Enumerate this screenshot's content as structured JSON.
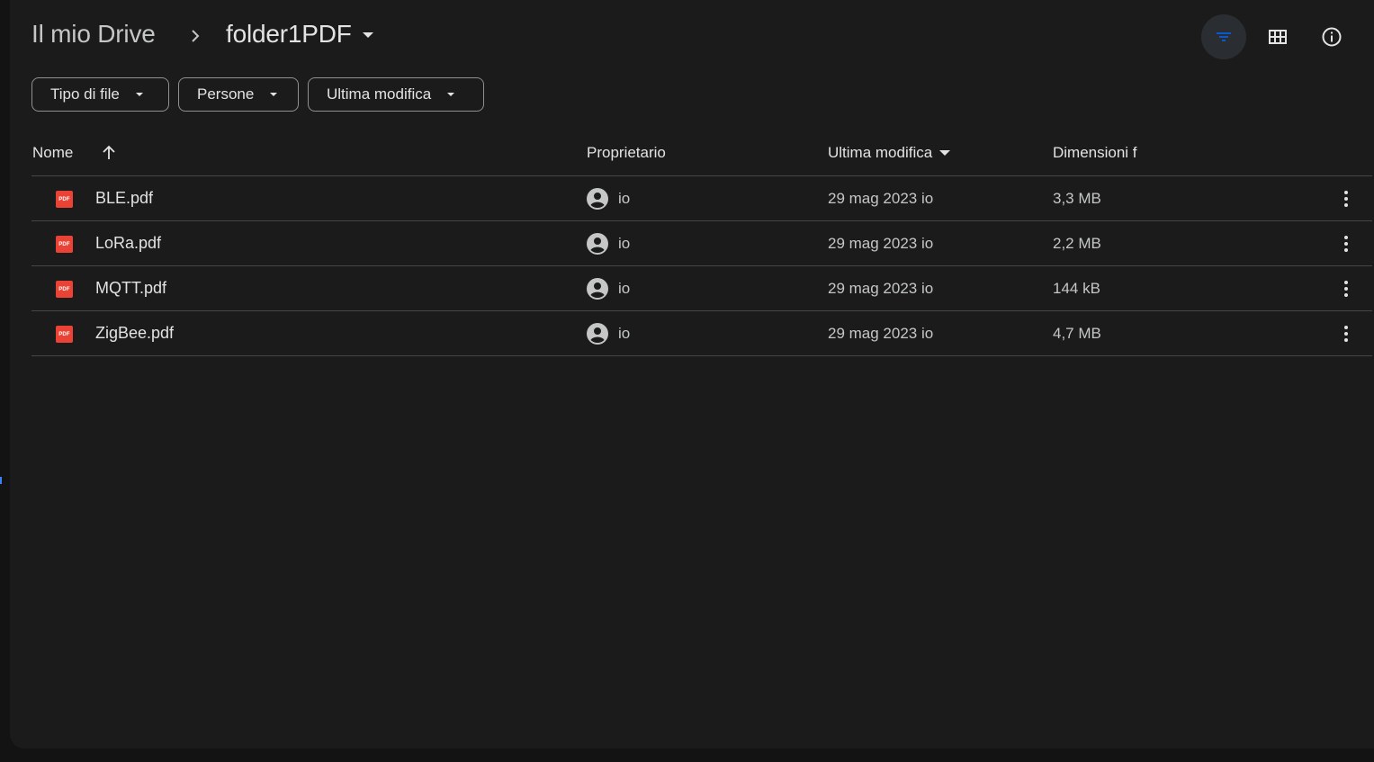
{
  "breadcrumb": {
    "root": "Il mio Drive",
    "current": "folder1PDF"
  },
  "toolbar": {
    "filter_icon": "filter-icon",
    "grid_icon": "grid-view-icon",
    "info_icon": "info-icon"
  },
  "filters": {
    "type": "Tipo di file",
    "people": "Persone",
    "modified": "Ultima modifica"
  },
  "columns": {
    "name": "Nome",
    "owner": "Proprietario",
    "modified": "Ultima modifica",
    "size": "Dimensioni f"
  },
  "files": [
    {
      "icon_label": "PDF",
      "name": "BLE.pdf",
      "owner": "io",
      "modified": "29 mag 2023 io",
      "size": "3,3 MB"
    },
    {
      "icon_label": "PDF",
      "name": "LoRa.pdf",
      "owner": "io",
      "modified": "29 mag 2023 io",
      "size": "2,2 MB"
    },
    {
      "icon_label": "PDF",
      "name": "MQTT.pdf",
      "owner": "io",
      "modified": "29 mag 2023 io",
      "size": "144 kB"
    },
    {
      "icon_label": "PDF",
      "name": "ZigBee.pdf",
      "owner": "io",
      "modified": "29 mag 2023 io",
      "size": "4,7 MB"
    }
  ],
  "colors": {
    "background": "#1b1b1c",
    "pdf_red": "#ea4335",
    "active_filter": "#0b57d0"
  }
}
